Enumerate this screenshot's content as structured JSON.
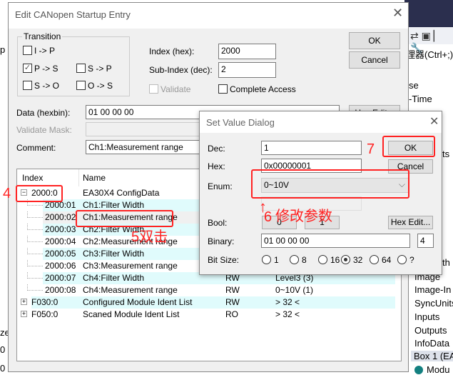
{
  "background": {
    "right_items": [
      "se",
      "-Time",
      "ts",
      "th",
      "Image",
      "Image-In",
      "SyncUnits",
      "Inputs",
      "Outputs",
      "InfoData",
      "Box 1 (EA",
      "Modu"
    ],
    "search_hint": "理器(Ctrl+;)",
    "left_items": [
      "p",
      "ze",
      "0",
      "0"
    ]
  },
  "main_dialog": {
    "title": "Edit CANopen Startup Entry",
    "transition": {
      "label": "Transition",
      "items": [
        {
          "label": "I -> P",
          "checked": false
        },
        {
          "label": "P -> S",
          "checked": true
        },
        {
          "label": "S -> P",
          "checked": false
        },
        {
          "label": "S -> O",
          "checked": false
        },
        {
          "label": "O -> S",
          "checked": false
        }
      ]
    },
    "index_label": "Index (hex):",
    "index_value": "2000",
    "subindex_label": "Sub-Index (dec):",
    "subindex_value": "2",
    "validate_label": "Validate",
    "complete_access_label": "Complete Access",
    "ok": "OK",
    "cancel": "Cancel",
    "hex_edit": "Hex Edit...",
    "data_label": "Data (hexbin):",
    "data_value": "01 00 00 00",
    "validate_mask_label": "Validate Mask:",
    "comment_label": "Comment:",
    "comment_value": "Ch1:Measurement range",
    "list": {
      "headers": [
        "Index",
        "Name"
      ],
      "rows": [
        {
          "index": "2000:0",
          "name": "EA30X4 ConfigData",
          "flags": "",
          "value": "",
          "expander": "−"
        },
        {
          "index": "2000:01",
          "name": "Ch1:Filter Width",
          "flags": "",
          "value": ""
        },
        {
          "index": "2000:02",
          "name": "Ch1:Measurement range",
          "flags": "",
          "value": ""
        },
        {
          "index": "2000:03",
          "name": "Ch2:Filter Width",
          "flags": "",
          "value": ""
        },
        {
          "index": "2000:04",
          "name": "Ch2:Measurement range",
          "flags": "",
          "value": ""
        },
        {
          "index": "2000:05",
          "name": "Ch3:Filter Width",
          "flags": "",
          "value": ""
        },
        {
          "index": "2000:06",
          "name": "Ch3:Measurement range",
          "flags": "",
          "value": ""
        },
        {
          "index": "2000:07",
          "name": "Ch4:Filter Width",
          "flags": "RW",
          "value": "Level3 (3)"
        },
        {
          "index": "2000:08",
          "name": "Ch4:Measurement range",
          "flags": "RW",
          "value": "0~10V (1)"
        },
        {
          "index": "F030:0",
          "name": "Configured Module Ident List",
          "flags": "RW",
          "value": "> 32 <",
          "expander": "+"
        },
        {
          "index": "F050:0",
          "name": "Scaned Module Ident List",
          "flags": "RO",
          "value": "> 32 <",
          "expander": "+"
        }
      ]
    }
  },
  "set_value_dialog": {
    "title": "Set Value Dialog",
    "dec_label": "Dec:",
    "dec_value": "1",
    "hex_label": "Hex:",
    "hex_value": "0x00000001",
    "enum_label": "Enum:",
    "enum_value": "0~10V",
    "bool_label": "Bool:",
    "bool_0": "0",
    "bool_1": "1",
    "binary_label": "Binary:",
    "binary_value": "01 00 00 00",
    "binary_len": "4",
    "bitsize_label": "Bit Size:",
    "bitsizes": [
      {
        "label": "1",
        "selected": false
      },
      {
        "label": "8",
        "selected": false
      },
      {
        "label": "16",
        "selected": false
      },
      {
        "label": "32",
        "selected": true
      },
      {
        "label": "64",
        "selected": false
      },
      {
        "label": "?",
        "selected": false
      }
    ],
    "ok": "OK",
    "cancel": "Cancel",
    "hex_edit": "Hex Edit..."
  },
  "annotations": {
    "step4": "4",
    "step5": "5双击",
    "step6": "6",
    "step6_text": "修改参数",
    "step7": "7",
    "color": "#ff2222"
  }
}
